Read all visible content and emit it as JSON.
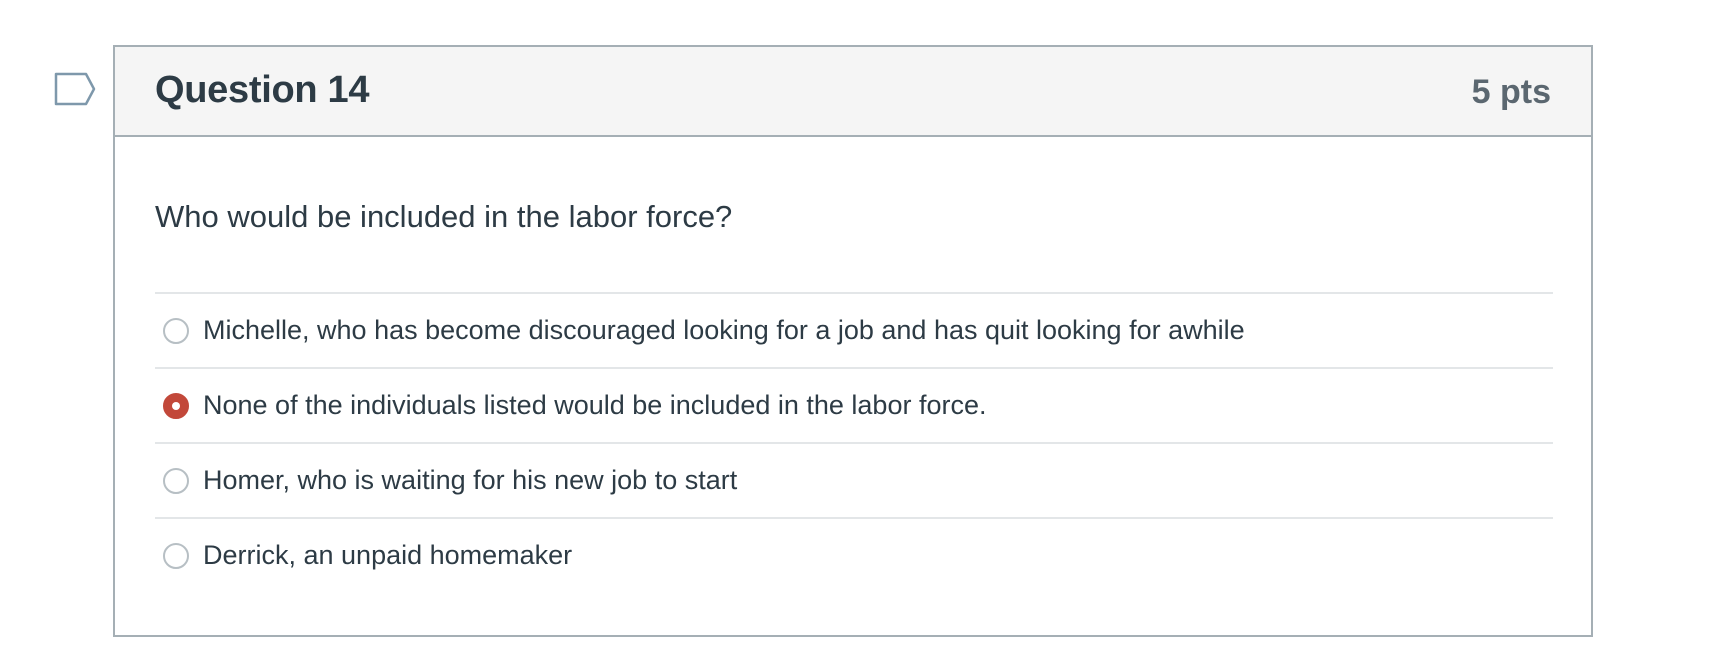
{
  "question": {
    "title": "Question 14",
    "points": "5 pts",
    "text": "Who would be included in the labor force?",
    "flag_icon": "flag-outline-icon",
    "accent_color": "#c2483a",
    "answers": [
      {
        "label": "Michelle, who has become discouraged looking for a job and has quit looking for awhile",
        "selected": false
      },
      {
        "label": "None of the individuals listed would be included in the labor force.",
        "selected": true
      },
      {
        "label": "Homer, who is waiting for his new job to start",
        "selected": false
      },
      {
        "label": "Derrick, an unpaid homemaker",
        "selected": false
      }
    ]
  }
}
